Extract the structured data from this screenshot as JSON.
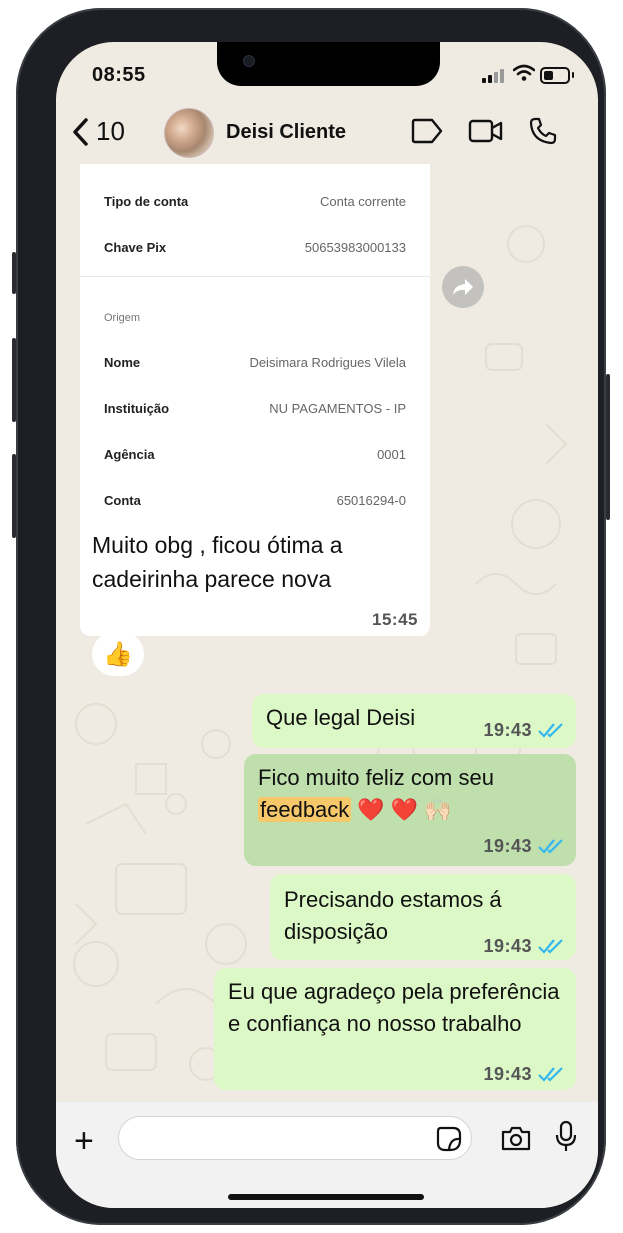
{
  "status_bar": {
    "time": "08:55"
  },
  "header": {
    "back_count": "10",
    "contact_name": "Deisi Cliente"
  },
  "icons": {
    "back": "chevron-left-icon",
    "label": "tag-icon",
    "video": "video-camera-icon",
    "call": "phone-icon",
    "forward": "forward-icon",
    "attach": "plus-icon",
    "sticker": "sticker-icon",
    "camera": "camera-icon",
    "mic": "microphone-icon"
  },
  "receipt": {
    "top_rows": [
      {
        "label": "Tipo de conta",
        "value": "Conta corrente"
      },
      {
        "label": "Chave Pix",
        "value": "50653983000133"
      }
    ],
    "section_title": "Origem",
    "origin_rows": [
      {
        "label": "Nome",
        "value": "Deisimara Rodrigues Vilela"
      },
      {
        "label": "Instituição",
        "value": "NU PAGAMENTOS - IP"
      },
      {
        "label": "Agência",
        "value": "0001"
      },
      {
        "label": "Conta",
        "value": "65016294-0"
      }
    ]
  },
  "incoming": {
    "caption": "Muito obg , ficou ótima a cadeirinha parece nova",
    "time": "15:45",
    "reaction": "👍"
  },
  "outgoing": [
    {
      "text": "Que legal Deisi",
      "time": "19:43"
    },
    {
      "text_before": "Fico muito feliz com seu ",
      "highlight": "feedback",
      "emoji": "❤️ ❤️ 🙌🏻",
      "time": "19:43",
      "selected": true
    },
    {
      "text": "Precisando estamos á disposição",
      "time": "19:43"
    },
    {
      "text": "Eu que agradeço pela preferência e confiança no nosso trabalho",
      "time": "19:43"
    }
  ],
  "colors": {
    "chat_bg": "#efeae2",
    "outgoing_bubble": "#dcf8c6",
    "selected_bubble": "#bfe0ad",
    "read_ticks": "#34b7f1",
    "highlight": "#f6c86a"
  },
  "composer": {
    "value": ""
  }
}
